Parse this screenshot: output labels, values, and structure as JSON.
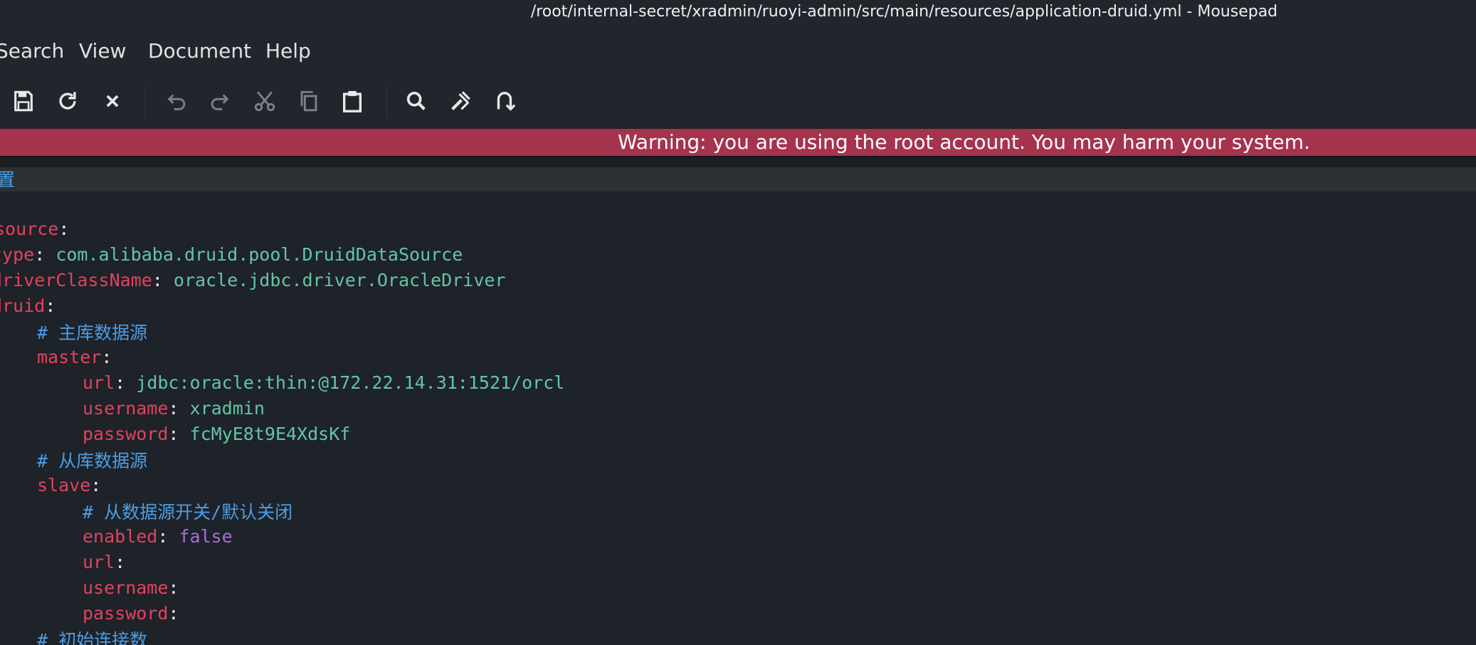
{
  "window": {
    "title": "/root/internal-secret/xradmin/ruoyi-admin/src/main/resources/application-druid.yml - Mousepad"
  },
  "menu": {
    "items": [
      "Search",
      "View",
      "Document",
      "Help"
    ]
  },
  "toolbar": {
    "icons": [
      "save-icon",
      "reload-icon",
      "close-icon",
      "undo-icon",
      "redo-icon",
      "cut-icon",
      "copy-icon",
      "paste-icon",
      "search-icon",
      "replace-icon",
      "goto-icon"
    ]
  },
  "warning": {
    "text": "Warning: you are using the root account. You may harm your system."
  },
  "editor": {
    "lines": [
      {
        "comment": "置"
      },
      {
        "key": "source",
        "colon": ":"
      },
      {
        "key": "type",
        "colon": ": ",
        "value": "com.alibaba.druid.pool.DruidDataSource"
      },
      {
        "key": "driverClassName",
        "colon": ": ",
        "value": "oracle.jdbc.driver.OracleDriver"
      },
      {
        "key": "druid",
        "colon": ":"
      },
      {
        "comment": "# 主库数据源"
      },
      {
        "key": "master",
        "colon": ":"
      },
      {
        "key": "url",
        "colon": ": ",
        "value": "jdbc:oracle:thin:@172.22.14.31:1521/orcl"
      },
      {
        "key": "username",
        "colon": ": ",
        "value": "xradmin"
      },
      {
        "key": "password",
        "colon": ": ",
        "value": "fcMyE8t9E4XdsKf"
      },
      {
        "comment": "# 从库数据源"
      },
      {
        "key": "slave",
        "colon": ":"
      },
      {
        "comment": "# 从数据源开关/默认关闭"
      },
      {
        "key": "enabled",
        "colon": ": ",
        "value": "false"
      },
      {
        "key": "url",
        "colon": ":"
      },
      {
        "key": "username",
        "colon": ":"
      },
      {
        "key": "password",
        "colon": ":"
      },
      {
        "comment": "# 初始连接数"
      }
    ]
  },
  "colors": {
    "background": "#1e2229",
    "chrome": "#22262c",
    "warning_bar": "#a6334d",
    "yaml_key": "#e3425f",
    "yaml_value": "#62c6a8",
    "yaml_boolean": "#a96ed6",
    "yaml_comment": "#4a9ee6"
  }
}
